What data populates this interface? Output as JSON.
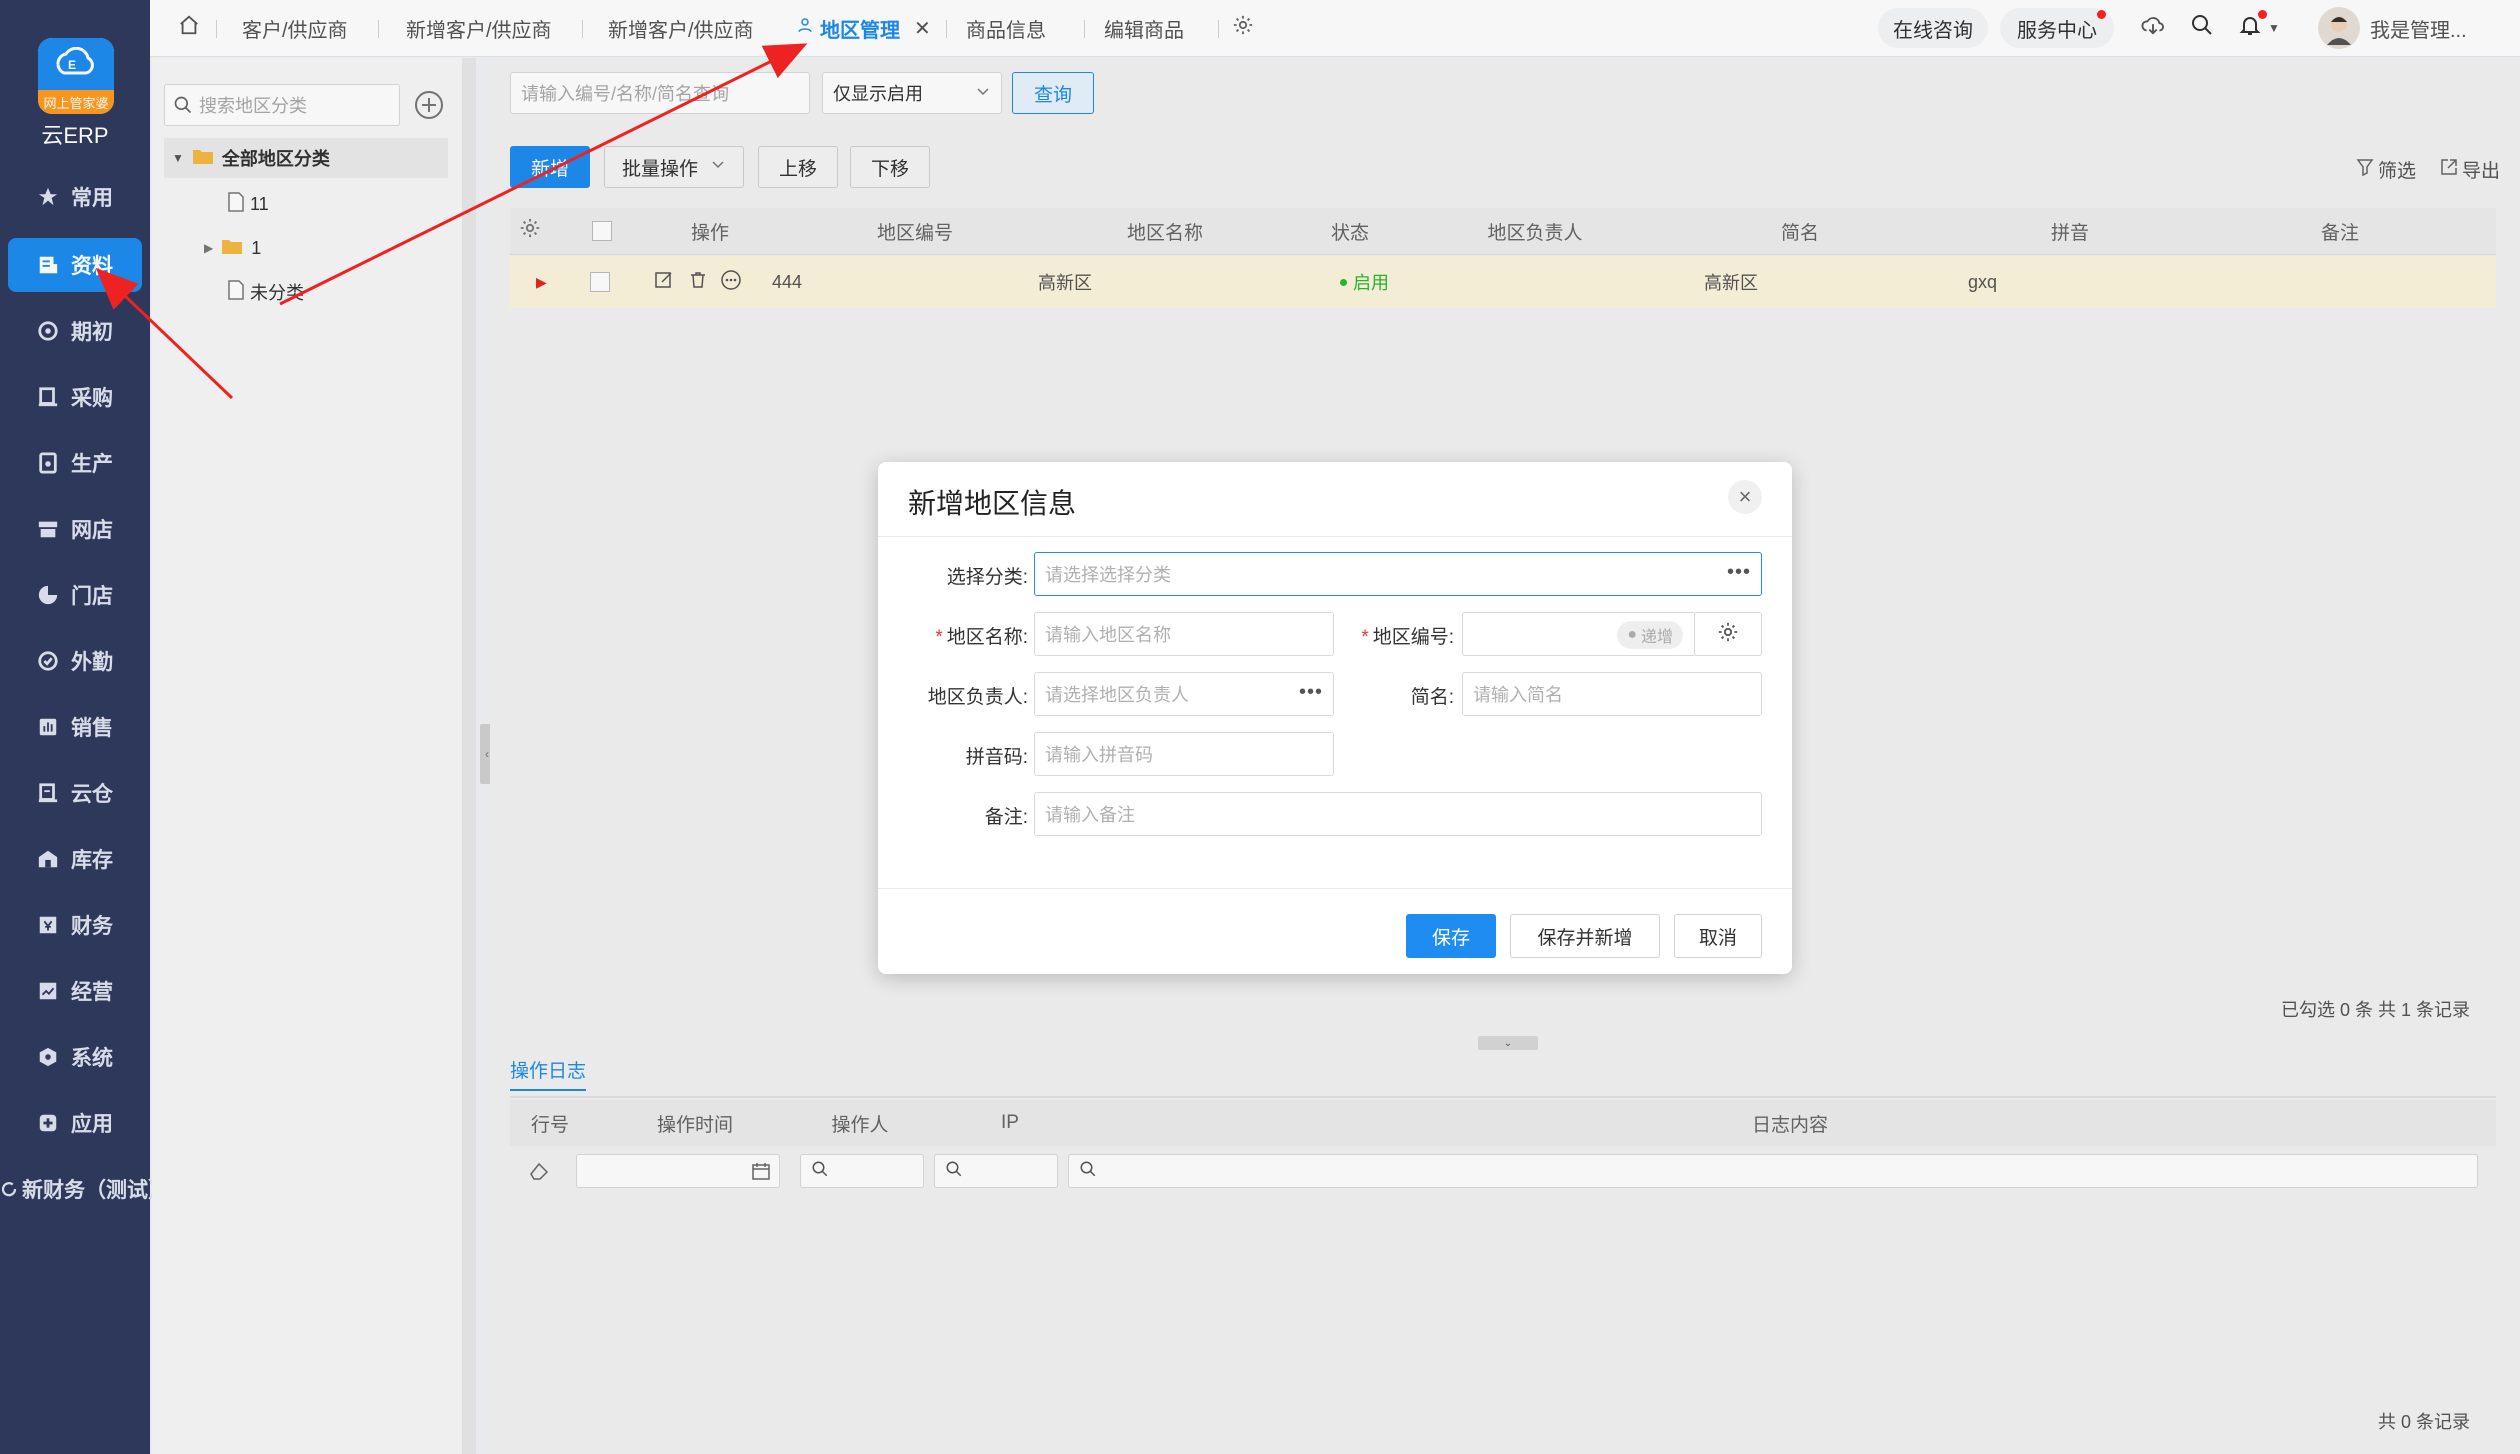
{
  "app": {
    "logo_badge": "网上管家婆",
    "logo_text": "云ERP"
  },
  "sidebar": {
    "items": [
      {
        "label": "常用",
        "icon": "star-icon"
      },
      {
        "label": "资料",
        "icon": "document-icon",
        "active": true
      },
      {
        "label": "期初",
        "icon": "target-icon"
      },
      {
        "label": "采购",
        "icon": "purchase-icon"
      },
      {
        "label": "生产",
        "icon": "production-icon"
      },
      {
        "label": "网店",
        "icon": "shop-icon"
      },
      {
        "label": "门店",
        "icon": "pie-icon"
      },
      {
        "label": "外勤",
        "icon": "fieldwork-icon"
      },
      {
        "label": "销售",
        "icon": "sales-chart-icon"
      },
      {
        "label": "云仓",
        "icon": "cloud-warehouse-icon"
      },
      {
        "label": "库存",
        "icon": "inventory-icon"
      },
      {
        "label": "财务",
        "icon": "finance-icon"
      },
      {
        "label": "经营",
        "icon": "business-icon"
      },
      {
        "label": "系统",
        "icon": "system-icon"
      },
      {
        "label": "应用",
        "icon": "plus-box-icon"
      },
      {
        "label": "新财务（测试）",
        "icon": "refresh-icon"
      }
    ]
  },
  "tabs": [
    {
      "label": "客户/供应商"
    },
    {
      "label": "新增客户/供应商"
    },
    {
      "label": "新增客户/供应商"
    },
    {
      "label": "地区管理",
      "active": true
    },
    {
      "label": "商品信息"
    },
    {
      "label": "编辑商品"
    }
  ],
  "topbar": {
    "online_consult": "在线咨询",
    "service_center": "服务中心",
    "user_name": "我是管理..."
  },
  "left_panel": {
    "search_placeholder": "搜索地区分类",
    "tree": {
      "root": "全部地区分类",
      "children": [
        "11",
        "1",
        "未分类"
      ]
    }
  },
  "toolbar": {
    "search_placeholder": "请输入编号/名称/简名查询",
    "filter_select": "仅显示启用",
    "query_button": "查询",
    "add_button": "新增",
    "batch_button": "批量操作",
    "move_up_button": "上移",
    "move_down_button": "下移",
    "filter_link": "筛选",
    "export_link": "导出"
  },
  "grid": {
    "columns": [
      "操作",
      "地区编号",
      "地区名称",
      "状态",
      "地区负责人",
      "简名",
      "拼音",
      "备注"
    ],
    "rows": [
      {
        "code": "444",
        "name": "高新区",
        "status": "启用",
        "manager": "",
        "short_name": "高新区",
        "pinyin": "gxq",
        "remark": ""
      }
    ],
    "summary": "已勾选 0 条  共 1 条记录"
  },
  "log": {
    "tab_label": "操作日志",
    "columns": [
      "行号",
      "操作时间",
      "操作人",
      "IP",
      "日志内容"
    ],
    "summary": "共 0 条记录"
  },
  "modal": {
    "title": "新增地区信息",
    "fields": {
      "category_label": "选择分类:",
      "category_placeholder": "请选择选择分类",
      "name_label": "地区名称:",
      "name_placeholder": "请输入地区名称",
      "code_label": "地区编号:",
      "code_toggle": "递增",
      "manager_label": "地区负责人:",
      "manager_placeholder": "请选择地区负责人",
      "short_label": "简名:",
      "short_placeholder": "请输入简名",
      "pinyin_label": "拼音码:",
      "pinyin_placeholder": "请输入拼音码",
      "remark_label": "备注:",
      "remark_placeholder": "请输入备注"
    },
    "buttons": {
      "save": "保存",
      "save_new": "保存并新增",
      "cancel": "取消"
    }
  },
  "colors": {
    "sidebar_bg": "#2f3a5e",
    "accent": "#1e8cf0",
    "status_enabled": "#2eb82e",
    "required_mark": "#e33333"
  }
}
